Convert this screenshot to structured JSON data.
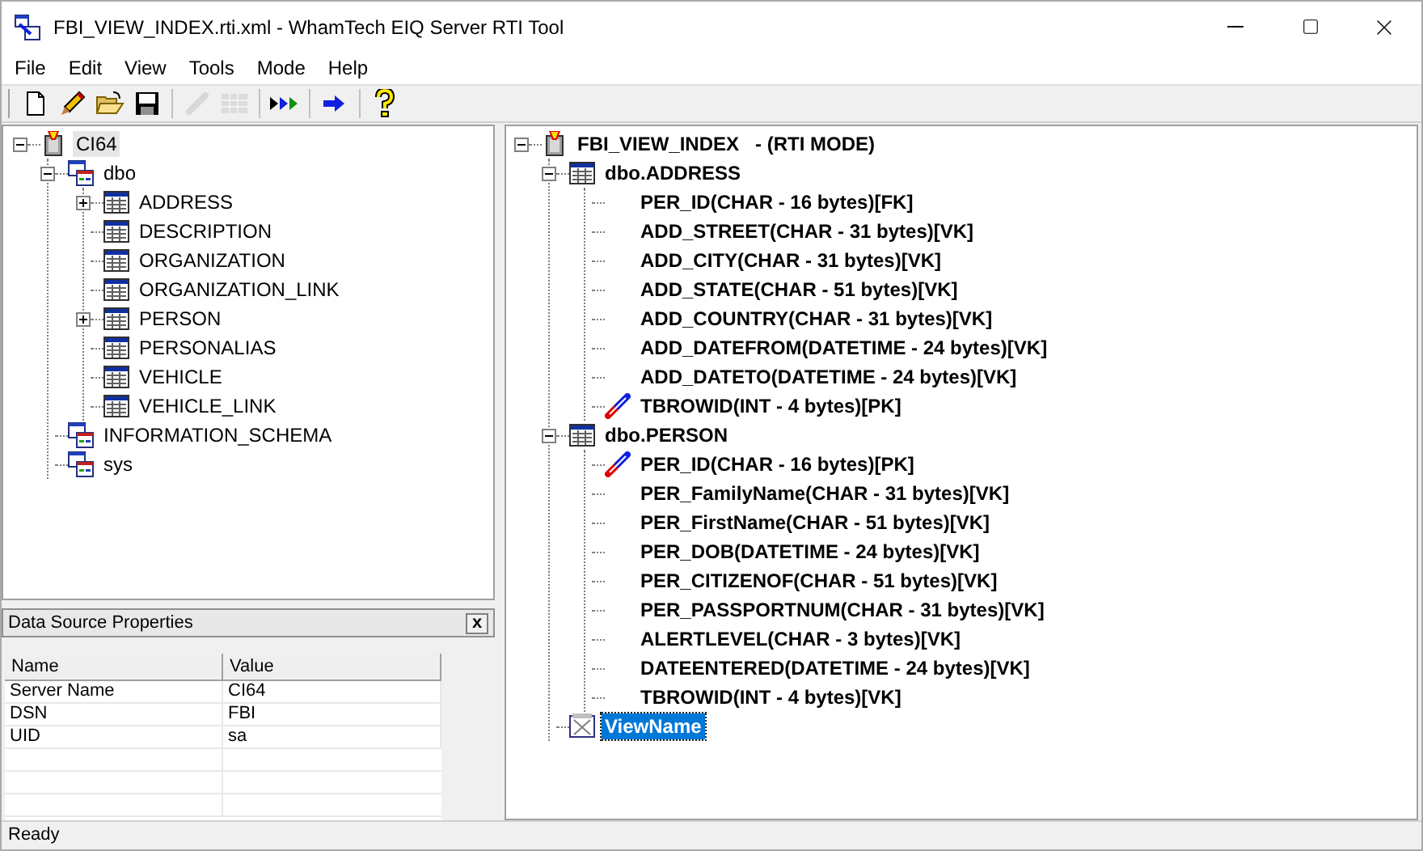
{
  "window": {
    "title": "FBI_VIEW_INDEX.rti.xml - WhamTech EIQ Server RTI Tool"
  },
  "menu": [
    "File",
    "Edit",
    "View",
    "Tools",
    "Mode",
    "Help"
  ],
  "toolbar": [
    {
      "kind": "new",
      "disabled": false
    },
    {
      "kind": "edit",
      "disabled": false
    },
    {
      "kind": "open",
      "disabled": false
    },
    {
      "kind": "save",
      "disabled": false
    },
    {
      "kind": "separator"
    },
    {
      "kind": "link",
      "disabled": true
    },
    {
      "kind": "grid",
      "disabled": true
    },
    {
      "kind": "separator"
    },
    {
      "kind": "run",
      "disabled": false
    },
    {
      "kind": "separator"
    },
    {
      "kind": "arrow",
      "disabled": false
    },
    {
      "kind": "separator"
    },
    {
      "kind": "help",
      "disabled": false
    }
  ],
  "left_tree": {
    "nodes": [
      {
        "label": "CI64",
        "kind": "server",
        "expanded": true,
        "selected": true,
        "children": [
          {
            "label": "dbo",
            "kind": "schema",
            "expanded": true,
            "selected": false,
            "children": [
              {
                "label": "ADDRESS",
                "kind": "table",
                "expanded": false,
                "selected": false
              },
              {
                "label": "DESCRIPTION",
                "kind": "table",
                "selected": false
              },
              {
                "label": "ORGANIZATION",
                "kind": "table",
                "selected": false
              },
              {
                "label": "ORGANIZATION_LINK",
                "kind": "table",
                "selected": false
              },
              {
                "label": "PERSON",
                "kind": "table",
                "expanded": false,
                "selected": false
              },
              {
                "label": "PERSONALIAS",
                "kind": "table",
                "selected": false
              },
              {
                "label": "VEHICLE",
                "kind": "table",
                "selected": false
              },
              {
                "label": "VEHICLE_LINK",
                "kind": "table",
                "selected": false
              }
            ]
          },
          {
            "label": "INFORMATION_SCHEMA",
            "kind": "schema",
            "selected": false
          },
          {
            "label": "sys",
            "kind": "schema",
            "selected": false
          }
        ]
      }
    ]
  },
  "properties": {
    "title": "Data Source Properties",
    "close": "x",
    "columns": [
      "Name",
      "Value"
    ],
    "rows": [
      [
        "Server Name",
        "CI64"
      ],
      [
        "DSN",
        "FBI"
      ],
      [
        "UID",
        "sa"
      ]
    ]
  },
  "right_tree": {
    "nodes": [
      {
        "label": "FBI_VIEW_INDEX   - (RTI MODE)",
        "kind": "server",
        "expanded": true,
        "selected": false,
        "children": [
          {
            "label": "dbo.ADDRESS",
            "kind": "table",
            "expanded": true,
            "selected": false,
            "children": [
              {
                "label": "PER_ID(CHAR - 16 bytes)[FK]",
                "kind": "column",
                "selected": false
              },
              {
                "label": "ADD_STREET(CHAR - 31 bytes)[VK]",
                "kind": "column",
                "selected": false
              },
              {
                "label": "ADD_CITY(CHAR - 31 bytes)[VK]",
                "kind": "column",
                "selected": false
              },
              {
                "label": "ADD_STATE(CHAR - 51 bytes)[VK]",
                "kind": "column",
                "selected": false
              },
              {
                "label": "ADD_COUNTRY(CHAR - 31 bytes)[VK]",
                "kind": "column",
                "selected": false
              },
              {
                "label": "ADD_DATEFROM(DATETIME - 24 bytes)[VK]",
                "kind": "column",
                "selected": false
              },
              {
                "label": "ADD_DATETO(DATETIME - 24 bytes)[VK]",
                "kind": "column",
                "selected": false
              },
              {
                "label": "TBROWID(INT - 4 bytes)[PK]",
                "kind": "key",
                "selected": false
              }
            ]
          },
          {
            "label": "dbo.PERSON",
            "kind": "table",
            "expanded": true,
            "selected": false,
            "children": [
              {
                "label": "PER_ID(CHAR - 16 bytes)[PK]",
                "kind": "key",
                "selected": false
              },
              {
                "label": "PER_FamilyName(CHAR - 31 bytes)[VK]",
                "kind": "column",
                "selected": false
              },
              {
                "label": "PER_FirstName(CHAR - 51 bytes)[VK]",
                "kind": "column",
                "selected": false
              },
              {
                "label": "PER_DOB(DATETIME - 24 bytes)[VK]",
                "kind": "column",
                "selected": false
              },
              {
                "label": "PER_CITIZENOF(CHAR - 51 bytes)[VK]",
                "kind": "column",
                "selected": false
              },
              {
                "label": "PER_PASSPORTNUM(CHAR - 31 bytes)[VK]",
                "kind": "column",
                "selected": false
              },
              {
                "label": "ALERTLEVEL(CHAR - 3 bytes)[VK]",
                "kind": "column",
                "selected": false
              },
              {
                "label": "DATEENTERED(DATETIME - 24 bytes)[VK]",
                "kind": "column",
                "selected": false
              },
              {
                "label": "TBROWID(INT - 4 bytes)[VK]",
                "kind": "column",
                "selected": false
              }
            ]
          },
          {
            "label": "ViewName",
            "kind": "view",
            "selected": true
          }
        ]
      }
    ]
  },
  "status_bar": "Ready"
}
